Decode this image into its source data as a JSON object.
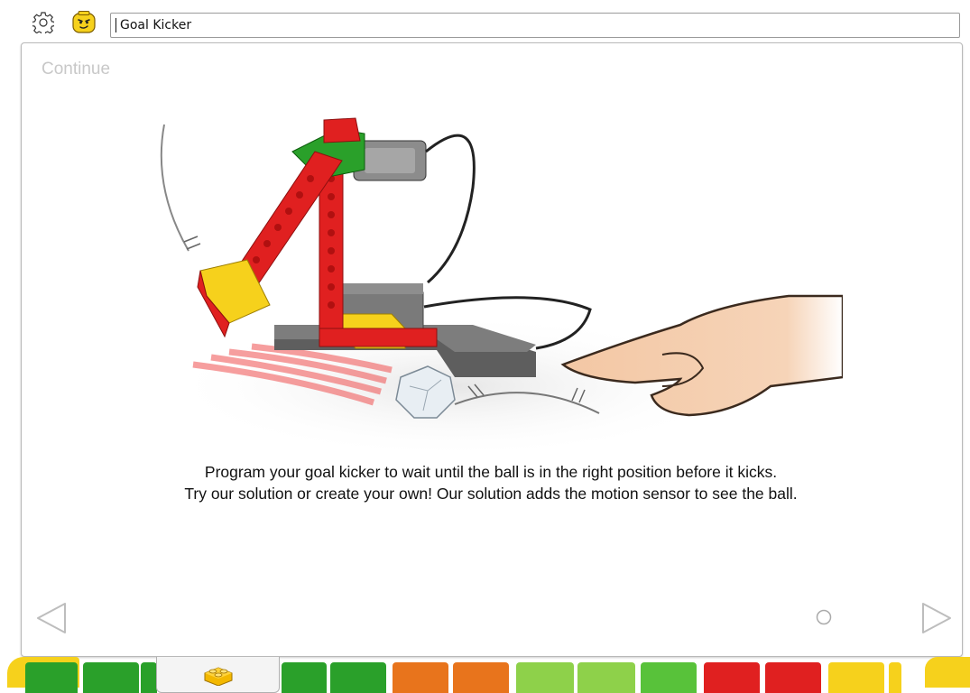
{
  "header": {
    "project_title": "Goal Kicker"
  },
  "content": {
    "continue_label": "Continue",
    "instruction_line1": "Program your goal kicker to wait until the ball is in the right position before it kicks.",
    "instruction_line2": "Try our solution or create your own! Our solution adds the motion sensor to see the ball."
  },
  "icons": {
    "settings": "gear-icon",
    "profile": "minifigure-face-icon",
    "previous": "triangle-left-icon",
    "next": "triangle-right-icon",
    "page": "page-indicator-dot",
    "palette_tab": "lego-brick-icon"
  },
  "colors": {
    "accent_yellow": "#f6d11c",
    "brick_red": "#e02020",
    "brick_green": "#2aa02a",
    "nav_gray": "#c8c8c8"
  }
}
